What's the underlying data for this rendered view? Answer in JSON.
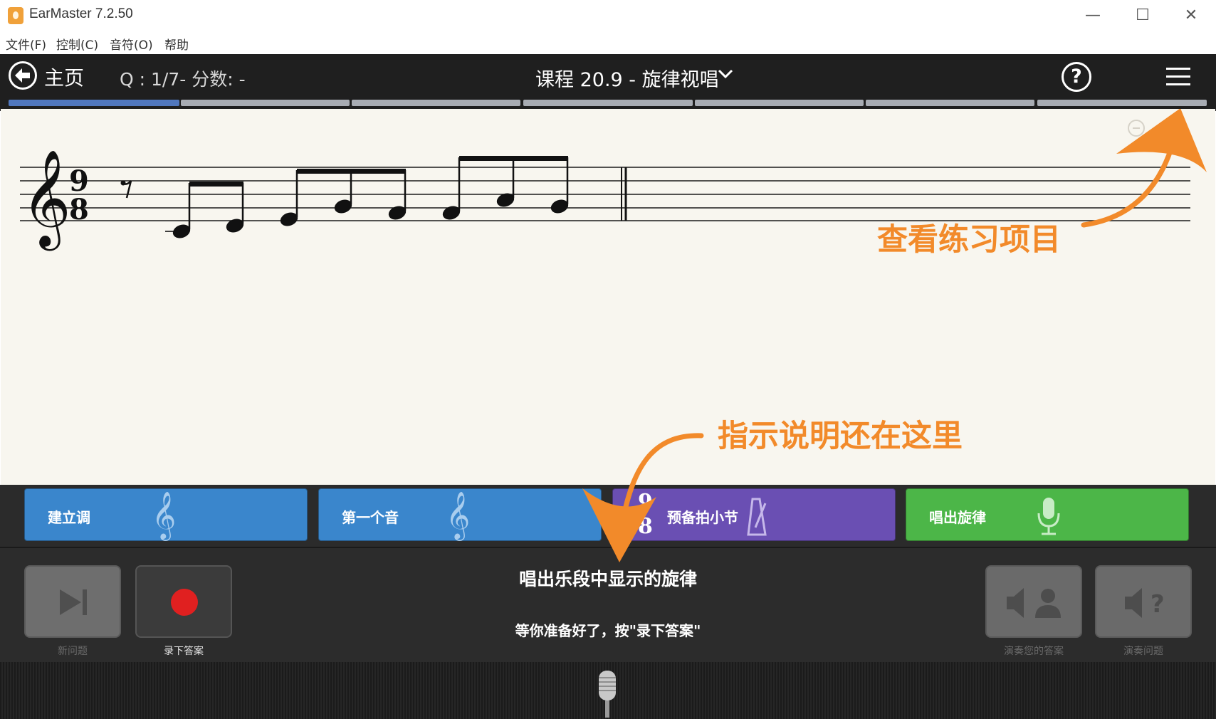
{
  "window": {
    "title": "EarMaster 7.2.50",
    "controls": {
      "minimize": "—",
      "maximize": "☐",
      "close": "✕"
    }
  },
  "menu": [
    "文件(F)",
    "控制(C)",
    "音符(O)",
    "帮助"
  ],
  "header": {
    "home_label": "主页",
    "score_text": "Q : 1/7- 分数: -",
    "lesson_title": "课程 20.9 - 旋律视唱",
    "help_icon": "?"
  },
  "progress": {
    "current": 1,
    "total": 7
  },
  "annotations": {
    "top_right": "查看练习项目",
    "bottom": "指示说明还在这里"
  },
  "steps": [
    {
      "label": "建立调",
      "color": "#3a86cc",
      "icon": "treble-clef-icon"
    },
    {
      "label": "第一个音",
      "color": "#3a86cc",
      "icon": "treble-clef-icon"
    },
    {
      "label": "预备拍小节",
      "color": "#6a4fb3",
      "icon": "metronome-icon",
      "time_signature": "9/8"
    },
    {
      "label": "唱出旋律",
      "color": "#4cb648",
      "icon": "microphone-icon"
    }
  ],
  "controls": {
    "next_question": "新问题",
    "record_answer": "录下答案",
    "play_your_answer": "演奏您的答案",
    "play_question": "演奏问题"
  },
  "instruction": {
    "title": "唱出乐段中显示的旋律",
    "subtitle": "等你准备好了，按\"录下答案\""
  },
  "time_signature": {
    "top": "9",
    "bottom": "8"
  },
  "accent_colors": {
    "annotation": "#f28a2a",
    "record": "#e02020",
    "progress": "#5077bd"
  }
}
